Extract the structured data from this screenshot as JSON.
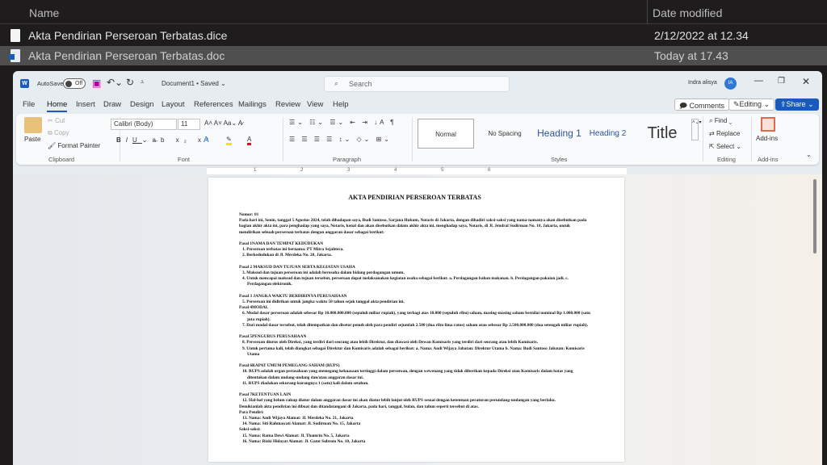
{
  "explorer": {
    "col_name": "Name",
    "col_date": "Date modified",
    "files": [
      {
        "name": "Akta Pendirian Perseroan Terbatas.dice",
        "date": "2/12/2022 at 12.34",
        "icon": "generic-file-icon"
      },
      {
        "name": "Akta Pendirian Perseroan Terbatas.doc",
        "date": "Today at 17.43",
        "icon": "word-file-icon",
        "selected": true
      }
    ]
  },
  "word": {
    "logo": "W",
    "autosave": "AutoSave",
    "autosave_state": "Off",
    "doc_name": "Document1 • Saved ⌄",
    "search_placeholder": "Search",
    "user": "Indra alisya",
    "user_initials": "IA",
    "tabs": [
      "File",
      "Home",
      "Insert",
      "Draw",
      "Design",
      "Layout",
      "References",
      "Mailings",
      "Review",
      "View",
      "Help"
    ],
    "active_tab": "Home",
    "comments": "Comments",
    "editing": "Editing ⌄",
    "share": "Share ⌄",
    "clipboard": {
      "paste": "Paste",
      "cut": "Cut",
      "copy": "Copy",
      "format_painter": "Format Painter",
      "label": "Clipboard"
    },
    "font": {
      "family": "Calibri (Body)",
      "size": "11",
      "label": "Font"
    },
    "paragraph": {
      "label": "Paragraph"
    },
    "styles": {
      "items": [
        "Normal",
        "No Spacing",
        "Heading 1",
        "Heading 2",
        "Title"
      ],
      "label": "Styles"
    },
    "editing_group": {
      "find": "Find ⌄",
      "replace": "Replace",
      "select": "Select ⌄",
      "label": "Editing"
    },
    "addins": {
      "button": "Add-ins",
      "label": "Add-ins"
    },
    "ruler_marks": [
      "1",
      "2",
      "3",
      "4",
      "5",
      "6"
    ],
    "accent": "#185abd"
  },
  "document": {
    "title": "AKTA PENDIRIAN PERSEROAN TERBATAS",
    "blocks": [
      {
        "t": "para",
        "text": "Nomor: 01"
      },
      {
        "t": "para",
        "text": "Pada hari ini, Senin, tanggal 5 Agustus 2024, telah dihadapan saya, Budi Santoso, Sarjana Hukum, Notaris di Jakarta, dengan dihadiri saksi-saksi yang nama-namanya akan disebutkan pada bagian akhir akta ini, para penghadap yang saya, Notaris, kenal dan akan disebutkan dalam akhir akta ini, menghadap saya, Notaris, di Jl. Jendral Sudirman No. 10, Jakarta, untuk mendirikan sebuah perseroan terbatas dengan anggaran dasar sebagai berikut:"
      },
      {
        "t": "gap"
      },
      {
        "t": "para",
        "text": "Pasal 1NAMA DAN TEMPAT KEDUDUKAN"
      },
      {
        "t": "item",
        "text": "1. Perseroan terbatas ini bernama: PT Mitra Sejahtera."
      },
      {
        "t": "item",
        "text": "2. Berkedudukan di Jl. Merdeka No. 20, Jakarta."
      },
      {
        "t": "gap"
      },
      {
        "t": "para",
        "text": "Pasal 2 MAKSUD DAN TUJUAN SERTA KEGIATAN USAHA"
      },
      {
        "t": "item",
        "text": "3. Maksud dan tujuan perseroan ini adalah berusaha dalam bidang perdagangan umum."
      },
      {
        "t": "item",
        "text": "4. Untuk mencapai maksud dan tujuan tersebut, perseroan dapat melaksanakan kegiatan usaha sebagai berikut: a. Perdagangan bahan makanan. b. Perdagangan pakaian jadi. c. Perdagangan elektronik."
      },
      {
        "t": "gap"
      },
      {
        "t": "para",
        "text": "Pasal 3 JANGKA WAKTU BERDIRINYA PERUSAHAAN"
      },
      {
        "t": "item",
        "text": "5. Perseroan ini didirikan untuk jangka waktu 50 tahun sejak tanggal akta pendirian ini."
      },
      {
        "t": "para",
        "text": "Pasal 4MODAL"
      },
      {
        "t": "item",
        "text": "6. Modal dasar perseroan adalah sebesar Rp 10.000.000.000 (sepuluh miliar rupiah), yang terbagi atas 10.000 (sepuluh ribu) saham, masing-masing saham bernilai nominal Rp 1.000.000 (satu juta rupiah)."
      },
      {
        "t": "item",
        "text": "7. Dari modal dasar tersebut, telah ditempatkan dan disetor penuh oleh para pendiri sejumlah 2.500 (dua ribu lima ratus) saham atau sebesar Rp 2.500.000.000 (dua setengah miliar rupiah)."
      },
      {
        "t": "gap"
      },
      {
        "t": "para",
        "text": "Pasal 5PENGURUS PERUSAHAAN"
      },
      {
        "t": "item",
        "text": "8. Perseroan diurus oleh Direksi, yang terdiri dari seorang atau lebih Direktur, dan diawasi oleh Dewan Komisaris yang terdiri dari seorang atau lebih Komisaris."
      },
      {
        "t": "item",
        "text": "9. Untuk pertama kali, telah diangkat sebagai Direktur dan Komisaris adalah sebagai berikut: a. Nama: Andi Wijaya Jabatan: Direktur Utama b. Nama: Budi Santoso Jabatan: Komisaris Utama"
      },
      {
        "t": "gap"
      },
      {
        "t": "para",
        "text": "Pasal 6RAPAT UMUM PEMEGANG SAHAM (RUPS)"
      },
      {
        "t": "item",
        "text": "10. RUPS adalah organ perusahaan yang memegang kekuasaan tertinggi dalam perseroan, dengan wewenang yang tidak diberikan kepada Direksi atau Komisaris dalam batas yang ditentukan dalam undang-undang dan/atau anggaran dasar ini."
      },
      {
        "t": "item",
        "text": "11. RUPS diadakan sekurang-kurangnya 1 (satu) kali dalam setahun."
      },
      {
        "t": "gap"
      },
      {
        "t": "para",
        "text": "Pasal 7KETENTUAN LAIN"
      },
      {
        "t": "item",
        "text": "12. Hal-hal yang belum cukup diatur dalam anggaran dasar ini akan diatur lebih lanjut oleh RUPS sesuai dengan ketentuan peraturan perundang-undangan yang berlaku."
      },
      {
        "t": "para",
        "text": "Demikianlah akta pendirian ini dibuat dan ditandatangani di Jakarta, pada hari, tanggal, bulan, dan tahun seperti tersebut di atas."
      },
      {
        "t": "para",
        "text": "Para Pendiri:"
      },
      {
        "t": "item",
        "text": "13. Nama: Andi Wijaya Alamat: Jl. Merdeka No. 21, Jakarta"
      },
      {
        "t": "item",
        "text": "14. Nama: Siti Rahmawati Alamat: Jl. Sudirman No. 15, Jakarta"
      },
      {
        "t": "para",
        "text": "Saksi-saksi:"
      },
      {
        "t": "item",
        "text": "15. Nama: Ratna Dewi Alamat: Jl. Thamrin No. 5, Jakarta"
      },
      {
        "t": "item",
        "text": "16. Nama: Rizki Hidayat Alamat: Jl. Gatot Subroto No. 10, Jakarta"
      }
    ]
  }
}
